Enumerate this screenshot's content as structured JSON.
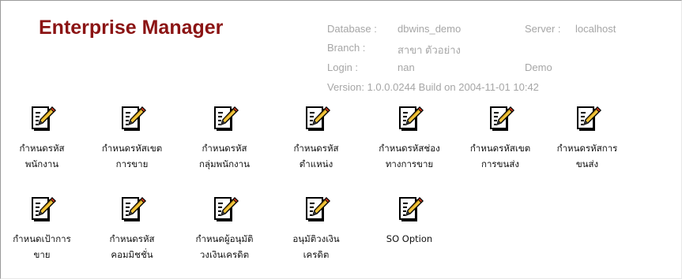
{
  "app": {
    "title": "Enterprise Manager"
  },
  "info": {
    "database_label": "Database :",
    "database_value": "dbwins_demo",
    "server_label": "Server :",
    "server_value": "localhost",
    "branch_label": "Branch :",
    "branch_value": "สาขา ตัวอย่าง",
    "login_label": "Login :",
    "login_value": "nan",
    "login_extra": "Demo",
    "version": "Version: 1.0.0.0244  Build on 2004-11-01 10:42"
  },
  "icons": [
    {
      "icon": "edit-document-icon",
      "line1": "กำหนดรหัส",
      "line2": "พนักงาน"
    },
    {
      "icon": "edit-document-icon",
      "line1": "กำหนดรหัสเขต",
      "line2": "การขาย"
    },
    {
      "icon": "edit-document-icon",
      "line1": "กำหนดรหัส",
      "line2": "กลุ่มพนักงาน"
    },
    {
      "icon": "edit-document-icon",
      "line1": "กำหนดรหัส",
      "line2": "ตำแหน่ง"
    },
    {
      "icon": "edit-document-icon",
      "line1": "กำหนดรหัสช่อง",
      "line2": "ทางการขาย"
    },
    {
      "icon": "edit-document-icon",
      "line1": "กำหนดรหัสเขต",
      "line2": "การขนส่ง"
    },
    {
      "icon": "edit-document-icon",
      "line1": "กำหนดรหัสการ",
      "line2": "ขนส่ง"
    },
    {
      "icon": "edit-document-icon",
      "line1": "กำหนดเป้าการ",
      "line2": "ขาย"
    },
    {
      "icon": "edit-document-icon",
      "line1": "กำหนดรหัส",
      "line2": "คอมมิชชั่น"
    },
    {
      "icon": "edit-document-icon",
      "line1": "กำหนดผู้อนุมัติ",
      "line2": "วงเงินเครดิต"
    },
    {
      "icon": "edit-document-icon",
      "line1": "อนุมัติวงเงิน",
      "line2": "เครดิต"
    },
    {
      "icon": "edit-document-icon",
      "line1": "SO Option",
      "line2": ""
    }
  ],
  "colors": {
    "title": "#8b1414",
    "info_text": "#a6a6a6",
    "pencil": "#f2c53d",
    "pencil_tip": "#d23b1e"
  }
}
